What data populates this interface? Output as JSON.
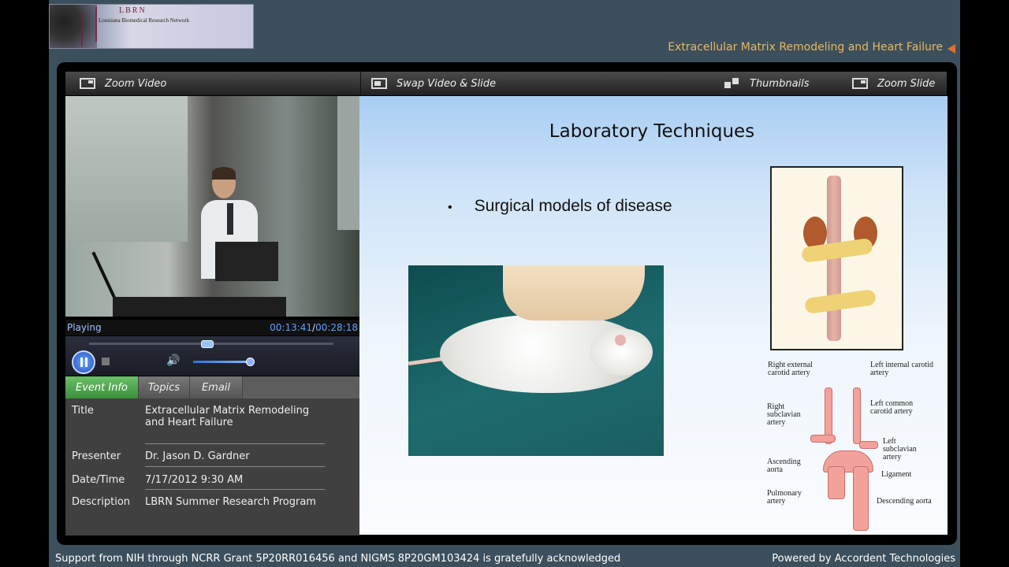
{
  "header": {
    "logo_text": "LBRN",
    "logo_subtext": "Louisiana Biomedical Research Network",
    "presentation_title": "Extracellular Matrix Remodeling and Heart Failure"
  },
  "toolbar": {
    "zoom_video": "Zoom Video",
    "swap_video_slide": "Swap Video & Slide",
    "thumbnails": "Thumbnails",
    "zoom_slide": "Zoom Slide"
  },
  "player": {
    "status": "Playing",
    "current_time": "00:13:41",
    "time_separator": "/",
    "total_time": "00:28:18",
    "seek_fraction": 0.48,
    "volume_fraction": 0.95
  },
  "tabs": [
    {
      "label": "Event Info",
      "active": true
    },
    {
      "label": "Topics",
      "active": false
    },
    {
      "label": "Email",
      "active": false
    }
  ],
  "event_info": {
    "title_label": "Title",
    "title_value": "Extracellular Matrix Remodeling and Heart Failure",
    "presenter_label": "Presenter",
    "presenter_value": "Dr. Jason D. Gardner",
    "datetime_label": "Date/Time",
    "datetime_value": "7/17/2012 9:30 AM",
    "description_label": "Description",
    "description_value": "LBRN Summer Research Program"
  },
  "slide": {
    "title": "Laboratory Techniques",
    "bullet": "Surgical models of disease",
    "anatomy_labels": {
      "right_external_carotid": "Right external carotid artery",
      "left_internal_carotid": "Left internal carotid artery",
      "right_subclavian": "Right subclavian artery",
      "left_common_carotid": "Left common carotid artery",
      "left_subclavian": "Left subclavian artery",
      "ascending_aorta": "Ascending aorta",
      "ligament": "Ligament",
      "pulmonary_artery": "Pulmonary artery",
      "descending_aorta": "Descending aorta"
    }
  },
  "footer": {
    "acknowledgement": "Support from NIH through NCRR Grant 5P20RR016456 and NIGMS 8P20GM103424 is gratefully acknowledged",
    "powered_by": "Powered by Accordent Technologies"
  }
}
